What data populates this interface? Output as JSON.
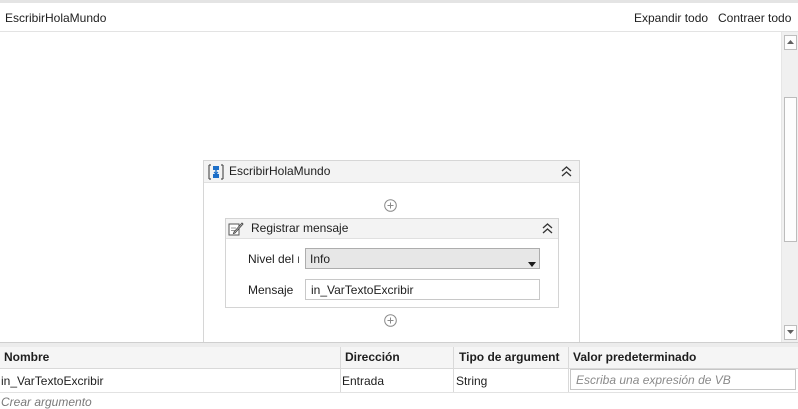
{
  "header": {
    "title": "EscribirHolaMundo",
    "expand_all": "Expandir todo",
    "collapse_all": "Contraer todo"
  },
  "sequence": {
    "title": "EscribirHolaMundo",
    "activity": {
      "title": "Registrar mensaje",
      "level_label": "Nivel del r",
      "level_value": "Info",
      "message_label": "Mensaje",
      "message_value": "in_VarTextoExcribir"
    }
  },
  "arguments": {
    "columns": [
      "Nombre",
      "Dirección",
      "Tipo de argument",
      "Valor predeterminado"
    ],
    "rows": [
      {
        "name": "in_VarTextoExcribir",
        "direction": "Entrada",
        "type": "String",
        "default_placeholder": "Escriba una expresión de VB"
      }
    ],
    "create_label": "Crear argumento"
  },
  "colors": {
    "icon_blue": "#1e6fc8",
    "header_bg": "#f3f3f3"
  }
}
